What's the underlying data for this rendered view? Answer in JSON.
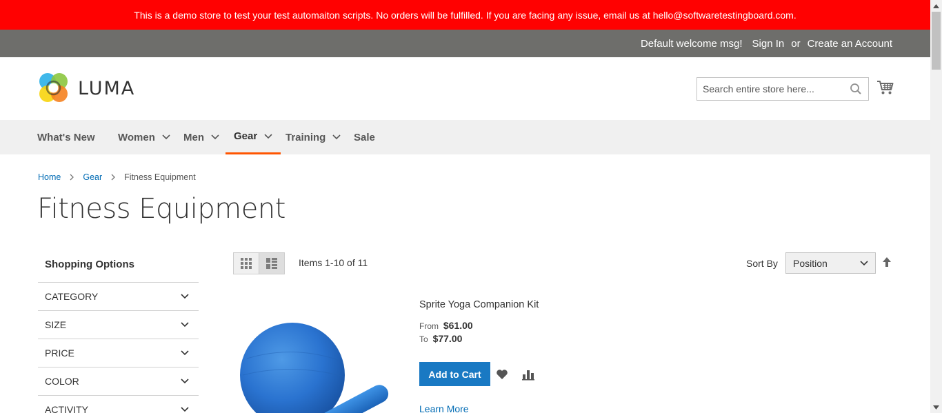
{
  "banner": {
    "text": "This is a demo store to test your test automaiton scripts. No orders will be fulfilled. If you are facing any issue, email us at hello@softwaretestingboard.com."
  },
  "topbar": {
    "welcome": "Default welcome msg!",
    "sign_in": "Sign In",
    "or": "or",
    "create_account": "Create an Account"
  },
  "header": {
    "logo_text": "LUMA",
    "search_placeholder": "Search entire store here...",
    "search_value": ""
  },
  "nav": {
    "items": [
      {
        "label": "What's New",
        "has_dropdown": false
      },
      {
        "label": "Women",
        "has_dropdown": true
      },
      {
        "label": "Men",
        "has_dropdown": true
      },
      {
        "label": "Gear",
        "has_dropdown": true,
        "active": true
      },
      {
        "label": "Training",
        "has_dropdown": true
      },
      {
        "label": "Sale",
        "has_dropdown": false
      }
    ]
  },
  "breadcrumb": {
    "home": "Home",
    "gear": "Gear",
    "current": "Fitness Equipment"
  },
  "page_title": "Fitness Equipment",
  "sidebar": {
    "title": "Shopping Options",
    "filters": [
      "CATEGORY",
      "SIZE",
      "PRICE",
      "COLOR",
      "ACTIVITY"
    ]
  },
  "toolbar": {
    "items_prefix": "Items ",
    "items_range": "1-10",
    "items_of": " of ",
    "items_total": "11",
    "sort_label": "Sort By",
    "sort_value": "Position",
    "view_mode": "list"
  },
  "product": {
    "name": "Sprite Yoga Companion Kit",
    "from_label": "From",
    "from_price": "$61.00",
    "to_label": "To",
    "to_price": "$77.00",
    "add_to_cart": "Add to Cart",
    "learn_more": "Learn More"
  },
  "colors": {
    "banner": "#ff0101",
    "topbar": "#6e6e6b",
    "nav_bg": "#f0f0f0",
    "accent": "#ff5501",
    "primary_button": "#1979c3",
    "link": "#006bb4"
  },
  "icons": {
    "search": "search-icon",
    "cart": "cart-icon",
    "wishlist": "heart-icon",
    "compare": "bar-chart-icon",
    "sort_direction": "arrow-up-icon"
  }
}
